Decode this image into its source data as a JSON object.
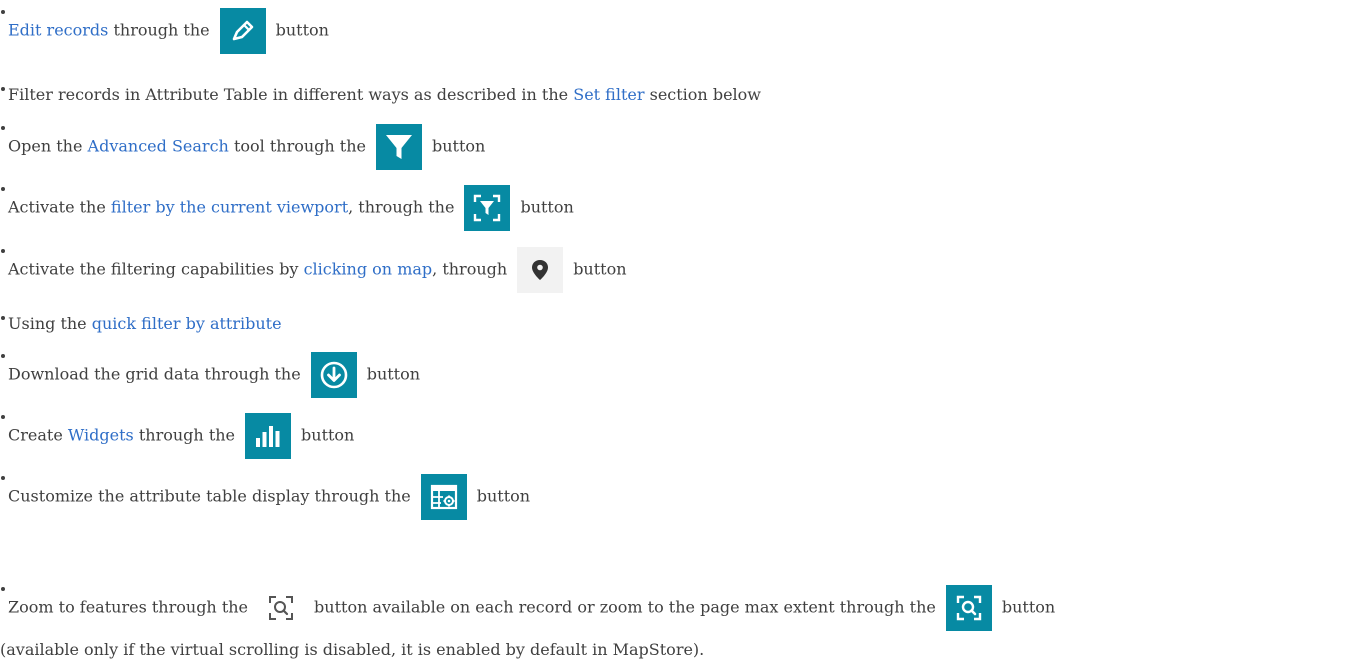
{
  "items": [
    {
      "link": "Edit records",
      "mid": "through the",
      "end": "button"
    },
    {
      "pre": "Filter records in Attribute Table in different ways as described in the",
      "link": "Set filter",
      "post": "section below"
    },
    {
      "pre": "Open the",
      "link": "Advanced Search",
      "mid": "tool through the",
      "end": "button"
    },
    {
      "pre": "Activate the",
      "link": "filter by the current viewport",
      "mid": ", through the",
      "end": "button"
    },
    {
      "pre": "Activate the filtering capabilities by",
      "link": "clicking on map",
      "mid": ", through",
      "end": "button"
    },
    {
      "pre": "Using the",
      "link": "quick filter by attribute"
    },
    {
      "pre": "Download the grid data through the",
      "end": "button"
    },
    {
      "pre": "Create",
      "link": "Widgets",
      "mid": "through the",
      "end": "button"
    },
    {
      "pre": "Customize the attribute table display through the",
      "end": "button"
    },
    {
      "pre": "Zoom to features through the",
      "mid": "button available on each record or zoom to the page max extent through the",
      "end": "button",
      "cont": "(available only if the virtual scrolling is disabled, it is enabled by default in MapStore)."
    }
  ],
  "icons": {
    "edit": "pencil-icon",
    "advanced_search": "funnel-icon",
    "viewport_filter": "viewport-funnel-icon",
    "map_click": "map-marker-icon",
    "download": "download-circle-icon",
    "widgets": "bar-chart-icon",
    "customize": "table-settings-icon",
    "zoom_record": "zoom-extent-icon",
    "zoom_page": "zoom-extent-icon"
  },
  "colors": {
    "accent": "#078aa3",
    "link": "#2f6ec7",
    "text": "#404040",
    "light_button": "#f2f2f2"
  }
}
